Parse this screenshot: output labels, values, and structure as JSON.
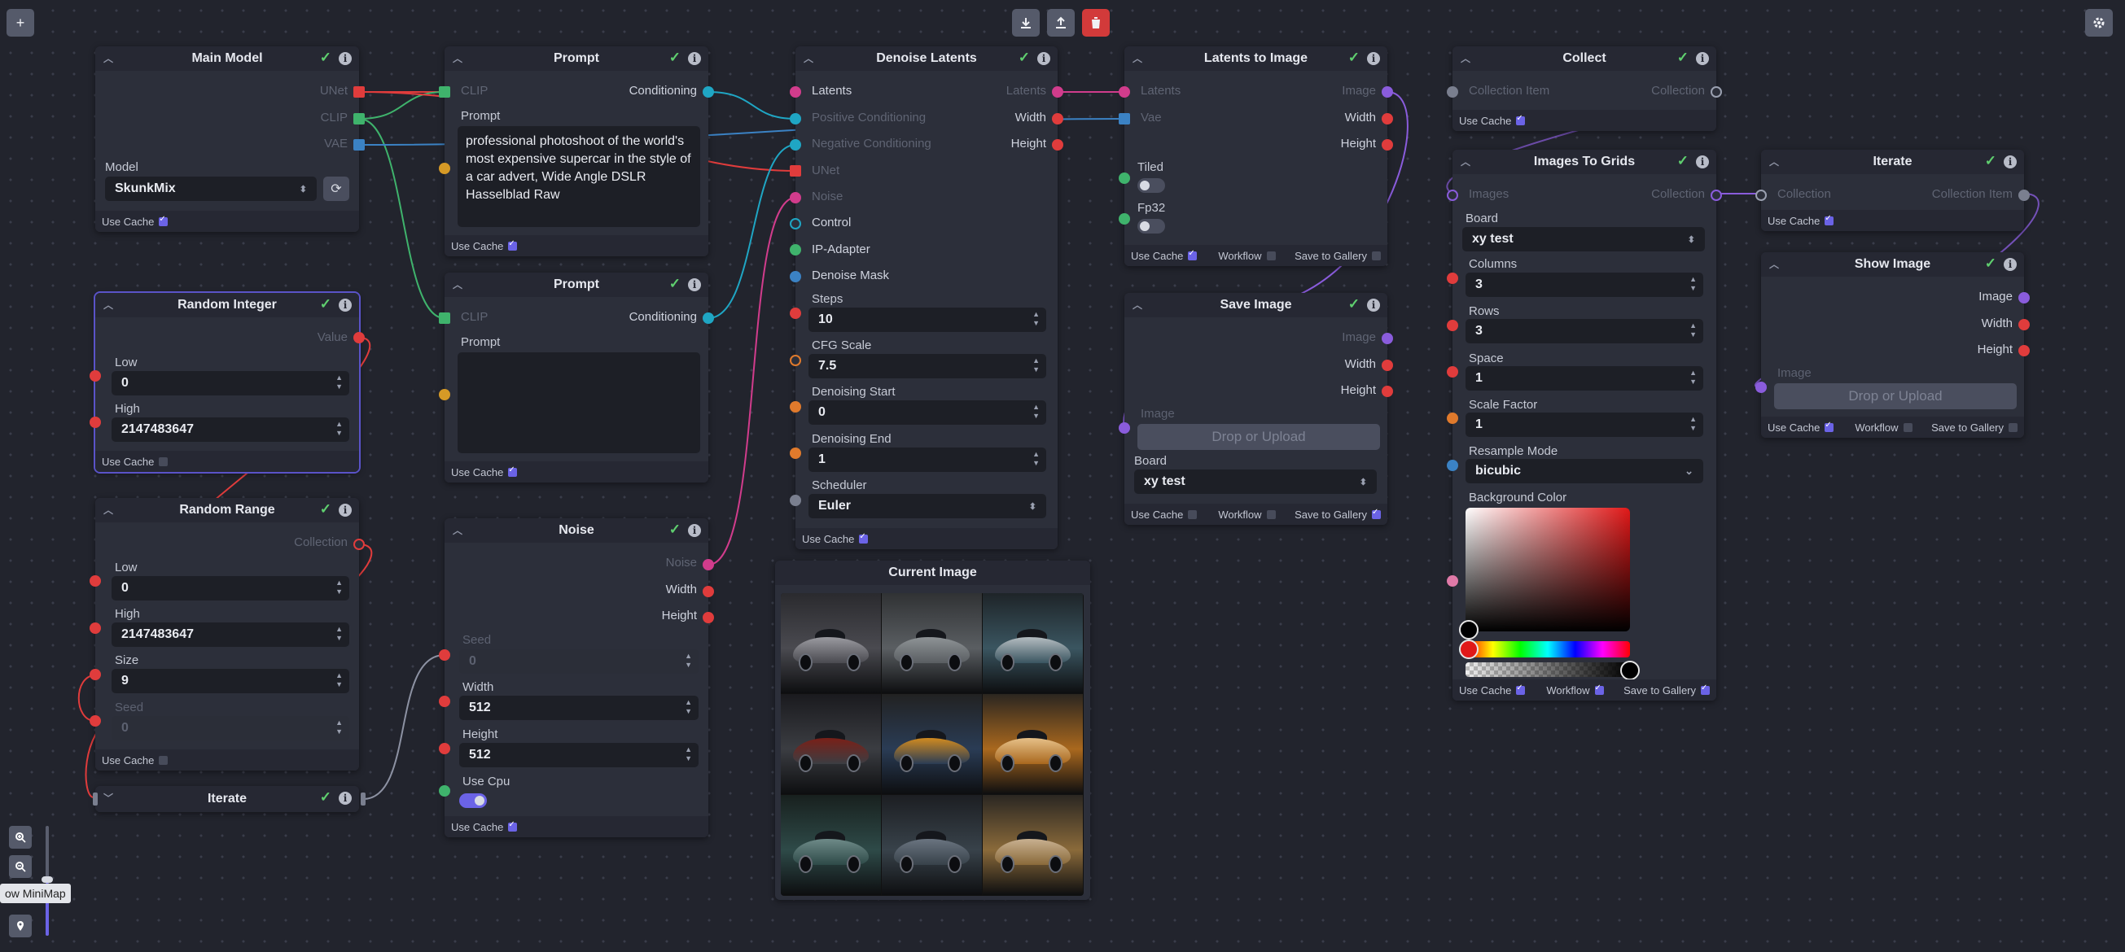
{
  "toolbar": {
    "add_icon": "+",
    "download_icon": "download-icon",
    "upload_icon": "upload-icon",
    "delete_icon": "trash-icon",
    "settings_icon": "gear-icon",
    "check": "✓",
    "info": "i",
    "chevron": "^"
  },
  "minimap": {
    "tooltip": "ow MiniMap"
  },
  "colors": {
    "accent": "#6b63e6",
    "unet": "#e03c3c",
    "clip": "#3fb36c",
    "vae": "#3b82c4",
    "conditioning": "#1fa6c4",
    "latents": "#d13c8c",
    "image": "#8a5cdc",
    "integer": "#e03c3c",
    "float": "#e07a2c"
  },
  "nodes": {
    "main_model": {
      "title": "Main Model",
      "outputs": [
        "UNet",
        "CLIP",
        "VAE"
      ],
      "model_label": "Model",
      "model_value": "SkunkMix",
      "use_cache": "Use Cache"
    },
    "prompt1": {
      "title": "Prompt",
      "clip": "CLIP",
      "conditioning": "Conditioning",
      "prompt_label": "Prompt",
      "prompt_value": "professional photoshoot of the world's most expensive supercar in the style of a car advert, Wide Angle DSLR Hasselblad Raw",
      "use_cache": "Use Cache"
    },
    "prompt2": {
      "title": "Prompt",
      "clip": "CLIP",
      "conditioning": "Conditioning",
      "prompt_label": "Prompt",
      "prompt_value": "",
      "use_cache": "Use Cache"
    },
    "random_integer": {
      "title": "Random Integer",
      "value": "Value",
      "low_label": "Low",
      "low": "0",
      "high_label": "High",
      "high": "2147483647",
      "use_cache": "Use Cache"
    },
    "random_range": {
      "title": "Random Range",
      "collection": "Collection",
      "low_label": "Low",
      "low": "0",
      "high_label": "High",
      "high": "2147483647",
      "size_label": "Size",
      "size": "9",
      "seed_label": "Seed",
      "seed": "0",
      "use_cache": "Use Cache"
    },
    "iterate_left": {
      "title": "Iterate"
    },
    "noise": {
      "title": "Noise",
      "outputs": [
        "Noise",
        "Width",
        "Height"
      ],
      "seed_label": "Seed",
      "seed": "0",
      "width_label": "Width",
      "width": "512",
      "height_label": "Height",
      "height": "512",
      "cpu_label": "Use Cpu",
      "use_cache": "Use Cache"
    },
    "denoise": {
      "title": "Denoise Latents",
      "inputs": [
        "Latents",
        "Positive Conditioning",
        "Negative Conditioning",
        "UNet",
        "Noise",
        "Control",
        "IP-Adapter",
        "Denoise Mask"
      ],
      "outputs": [
        "Latents",
        "Width",
        "Height"
      ],
      "steps_label": "Steps",
      "steps": "10",
      "cfg_label": "CFG Scale",
      "cfg": "7.5",
      "dstart_label": "Denoising Start",
      "dstart": "0",
      "dend_label": "Denoising End",
      "dend": "1",
      "scheduler_label": "Scheduler",
      "scheduler": "Euler",
      "use_cache": "Use Cache"
    },
    "current_image": {
      "title": "Current Image"
    },
    "l2i": {
      "title": "Latents to Image",
      "latents": "Latents",
      "vae": "Vae",
      "outputs": [
        "Image",
        "Width",
        "Height"
      ],
      "tiled": "Tiled",
      "fp32": "Fp32",
      "use_cache": "Use Cache",
      "workflow": "Workflow",
      "save_gallery": "Save to Gallery"
    },
    "save_image": {
      "title": "Save Image",
      "outputs": [
        "Image",
        "Width",
        "Height"
      ],
      "image_label": "Image",
      "drop": "Drop or Upload",
      "board_label": "Board",
      "board": "xy test",
      "use_cache": "Use Cache",
      "workflow": "Workflow",
      "save_gallery": "Save to Gallery"
    },
    "collect": {
      "title": "Collect",
      "item": "Collection Item",
      "collection": "Collection",
      "use_cache": "Use Cache"
    },
    "grids": {
      "title": "Images To Grids",
      "images": "Images",
      "collection": "Collection",
      "board_label": "Board",
      "board": "xy test",
      "columns_label": "Columns",
      "columns": "3",
      "rows_label": "Rows",
      "rows": "3",
      "space_label": "Space",
      "space": "1",
      "scale_label": "Scale Factor",
      "scale": "1",
      "resample_label": "Resample Mode",
      "resample": "bicubic",
      "bg_label": "Background Color",
      "use_cache": "Use Cache",
      "workflow": "Workflow",
      "save_gallery": "Save to Gallery"
    },
    "iterate_right": {
      "title": "Iterate",
      "collection": "Collection",
      "item": "Collection Item",
      "use_cache": "Use Cache"
    },
    "show_image": {
      "title": "Show Image",
      "outputs": [
        "Image",
        "Width",
        "Height"
      ],
      "image_label": "Image",
      "drop": "Drop or Upload",
      "use_cache": "Use Cache",
      "workflow": "Workflow",
      "save_gallery": "Save to Gallery"
    }
  }
}
